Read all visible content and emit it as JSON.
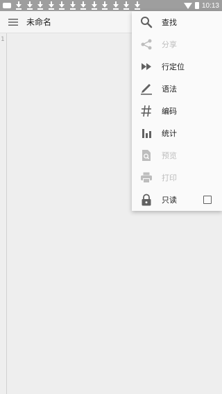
{
  "status_bar": {
    "time": "10:13",
    "download_count": 12
  },
  "toolbar": {
    "title": "未命名",
    "menu_icon": "hamburger-menu-icon"
  },
  "editor": {
    "line_number": "1"
  },
  "menu": {
    "items": [
      {
        "label": "查找",
        "icon": "search-icon",
        "enabled": true
      },
      {
        "label": "分享",
        "icon": "share-icon",
        "enabled": false
      },
      {
        "label": "行定位",
        "icon": "fast-forward-icon",
        "enabled": true
      },
      {
        "label": "语法",
        "icon": "pen-underline-icon",
        "enabled": true
      },
      {
        "label": "编码",
        "icon": "hash-icon",
        "enabled": true
      },
      {
        "label": "统计",
        "icon": "bar-chart-icon",
        "enabled": true
      },
      {
        "label": "预览",
        "icon": "preview-file-icon",
        "enabled": false
      },
      {
        "label": "打印",
        "icon": "printer-icon",
        "enabled": false
      },
      {
        "label": "只读",
        "icon": "lock-icon",
        "enabled": true,
        "checkbox_checked": false
      }
    ]
  },
  "colors": {
    "status_bar": "#9e9e9e",
    "icon_active": "#616161",
    "icon_disabled": "#bdbdbd",
    "text_primary": "#212121",
    "text_disabled": "#bdbdbd"
  }
}
